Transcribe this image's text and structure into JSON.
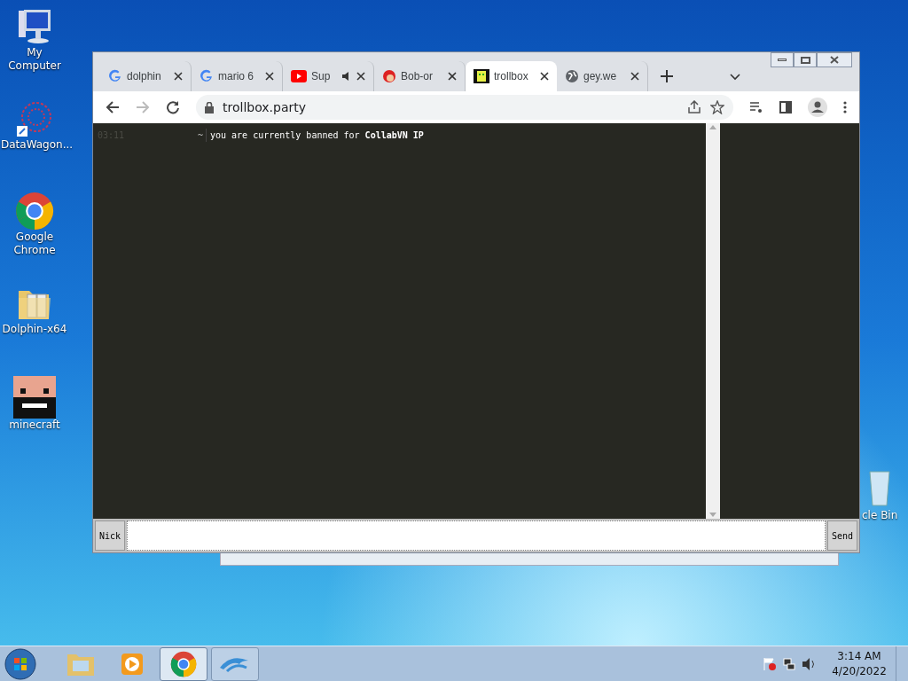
{
  "desktop_icons": [
    {
      "label": "My Computer",
      "kind": "computer"
    },
    {
      "label": "DataWagon...",
      "kind": "web"
    },
    {
      "label": "Google Chrome",
      "kind": "chrome"
    },
    {
      "label": "Dolphin-x64",
      "kind": "folder"
    },
    {
      "label": "minecraft",
      "kind": "face"
    }
  ],
  "recycle_bin": {
    "label": "cle Bin"
  },
  "browser": {
    "tabs": [
      {
        "title": "dolphin",
        "kind": "google",
        "selected": false,
        "audio": false
      },
      {
        "title": "mario 6",
        "kind": "google",
        "selected": false,
        "audio": false
      },
      {
        "title": "Sup",
        "kind": "youtube",
        "selected": false,
        "audio": true
      },
      {
        "title": "Bob-or",
        "kind": "mario",
        "selected": false,
        "audio": false
      },
      {
        "title": "trollbox",
        "kind": "troll",
        "selected": true,
        "audio": false
      },
      {
        "title": "gey.we",
        "kind": "globe",
        "selected": false,
        "audio": false
      }
    ],
    "url": "trollbox.party"
  },
  "chat": {
    "messages": [
      {
        "time": "03:11",
        "nick": "~",
        "text": "you are currently banned for **CollabVN IP**"
      }
    ],
    "nick_button": "Nick",
    "send_button": "Send"
  },
  "taskbar": {
    "items": [
      {
        "kind": "explorer",
        "active": false
      },
      {
        "kind": "media",
        "active": false
      },
      {
        "kind": "chrome",
        "active": true
      },
      {
        "kind": "dolphin",
        "active": false
      }
    ],
    "time": "3:14 AM",
    "date": "4/20/2022"
  }
}
